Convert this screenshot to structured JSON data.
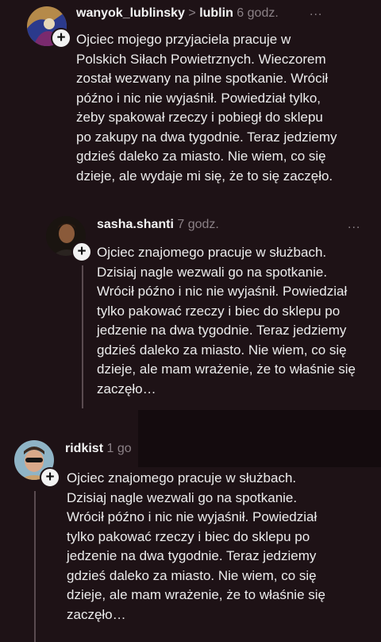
{
  "posts": [
    {
      "username": "wanyok_lublinsky",
      "community": "lublin",
      "time": "6 godz.",
      "more": "...",
      "lines": [
        "Ojciec mojego przyjaciela pracuje w",
        "Polskich Siłach Powietrznych. Wieczorem",
        "został wezwany na pilne spotkanie. Wrócił",
        "późno i nic nie wyjaśnił. Powiedział tylko,",
        "żeby spakował rzeczy i pobiegł do sklepu",
        "po zakupy na dwa tygodnie. Teraz jedziemy",
        "gdzieś daleko za miasto. Nie wiem, co się",
        "dzieje, ale wydaje mi się, że to się zaczęło."
      ]
    },
    {
      "username": "sasha.shanti",
      "time": "7 godz.",
      "more": "...",
      "lines": [
        "Ojciec znajomego pracuje w służbach.",
        "Dzisiaj nagle wezwali go na spotkanie.",
        "Wrócił późno i nic nie wyjaśnił. Powiedział",
        "tylko pakować rzeczy i biec do sklepu po",
        "jedzenie na dwa tygodnie. Teraz jedziemy",
        "gdzieś daleko za miasto. Nie wiem, co się",
        "dzieje, ale mam wrażenie, że to właśnie się",
        "zaczęło…"
      ]
    },
    {
      "username": "ridkist",
      "time": "1 go",
      "lines": [
        "Ojciec znajomego pracuje w służbach.",
        "Dzisiaj nagle wezwali go na spotkanie.",
        "Wrócił późno i nic nie wyjaśnił. Powiedział",
        "tylko pakować rzeczy i biec do sklepu po",
        "jedzenie na dwa tygodnie. Teraz jedziemy",
        "gdzieś daleko za miasto. Nie wiem, co się",
        "dzieje, ale mam wrażenie, że to właśnie się",
        "zaczęło…"
      ]
    }
  ],
  "icons": {
    "follow": "plus-icon",
    "separator": "chevron-right-icon",
    "more": "more-options-icon"
  },
  "plus_glyph": "+",
  "separator_glyph": ">"
}
